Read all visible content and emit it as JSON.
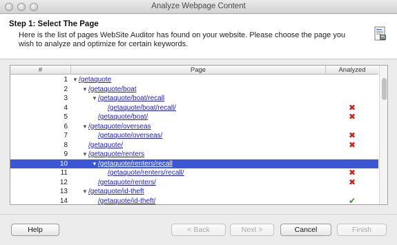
{
  "window": {
    "title": "Analyze Webpage Content"
  },
  "header": {
    "step_title": "Step 1: Select The Page",
    "description": "Here is the list of pages WebSite Auditor has found on your website. Please choose the page you wish to analyze and optimize for certain keywords."
  },
  "table": {
    "columns": {
      "num": "#",
      "page": "Page",
      "analyzed": "Analyzed"
    },
    "rows": [
      {
        "num": "1",
        "depth": 0,
        "expandable": true,
        "page": "/getaquote",
        "analyzed": "",
        "selected": false
      },
      {
        "num": "2",
        "depth": 1,
        "expandable": true,
        "page": "/getaquote/boat",
        "analyzed": "",
        "selected": false
      },
      {
        "num": "3",
        "depth": 2,
        "expandable": true,
        "page": "/getaquote/boat/recall",
        "analyzed": "",
        "selected": false
      },
      {
        "num": "4",
        "depth": 3,
        "expandable": false,
        "page": "/getaquote/boat/recall/",
        "analyzed": "✖",
        "selected": false
      },
      {
        "num": "5",
        "depth": 2,
        "expandable": false,
        "page": "/getaquote/boat/",
        "analyzed": "✖",
        "selected": false
      },
      {
        "num": "6",
        "depth": 1,
        "expandable": true,
        "page": "/getaquote/overseas",
        "analyzed": "",
        "selected": false
      },
      {
        "num": "7",
        "depth": 2,
        "expandable": false,
        "page": "/getaquote/overseas/",
        "analyzed": "✖",
        "selected": false
      },
      {
        "num": "8",
        "depth": 1,
        "expandable": false,
        "page": "/getaquote/",
        "analyzed": "✖",
        "selected": false
      },
      {
        "num": "9",
        "depth": 1,
        "expandable": true,
        "page": "/getaquote/renters",
        "analyzed": "",
        "selected": false
      },
      {
        "num": "10",
        "depth": 2,
        "expandable": true,
        "page": "/getaquote/renters/recall",
        "analyzed": "",
        "selected": true
      },
      {
        "num": "11",
        "depth": 3,
        "expandable": false,
        "page": "/getaquote/renters/recall/",
        "analyzed": "✖",
        "selected": false
      },
      {
        "num": "12",
        "depth": 2,
        "expandable": false,
        "page": "/getaquote/renters/",
        "analyzed": "✖",
        "selected": false
      },
      {
        "num": "13",
        "depth": 1,
        "expandable": true,
        "page": "/getaquote/id-theft",
        "analyzed": "",
        "selected": false
      },
      {
        "num": "14",
        "depth": 2,
        "expandable": false,
        "page": "/getaquote/id-theft/",
        "analyzed": "✔",
        "selected": false
      }
    ]
  },
  "buttons": {
    "help": "Help",
    "back": "< Back",
    "next": "Next >",
    "cancel": "Cancel",
    "finish": "Finish"
  },
  "colors": {
    "selection": "#3b57d6",
    "link": "#1a1ac8",
    "not_analyzed_mark": "#c9261c",
    "analyzed_mark": "#2e9a22"
  },
  "icons": {
    "window_close": "close-icon",
    "window_minimize": "minimize-icon",
    "window_maximize": "maximize-icon",
    "wizard": "page-analysis-icon",
    "expand": "triangle-down-icon",
    "not_analyzed": "red-x-icon",
    "analyzed": "green-check-icon"
  }
}
